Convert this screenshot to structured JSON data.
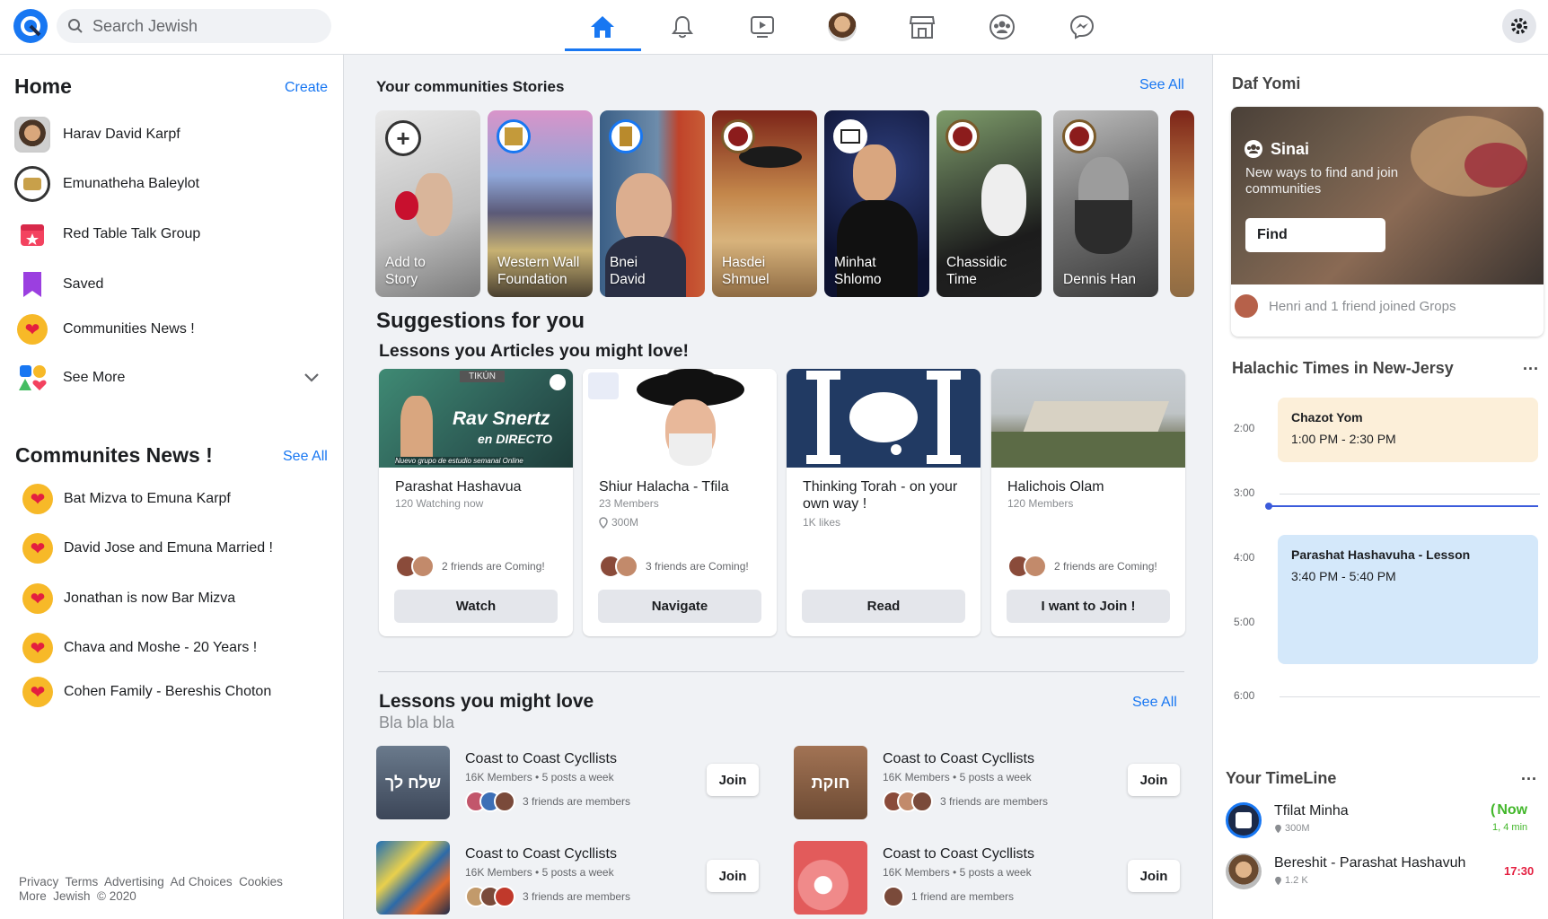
{
  "topbar": {
    "search_placeholder": "Search Jewish",
    "nav_icons": [
      "home-icon",
      "bell-icon",
      "video-icon",
      "profile-avatar",
      "marketplace-icon",
      "groups-icon",
      "messenger-icon"
    ],
    "settings_icon": "gear-icon"
  },
  "left": {
    "title": "Home",
    "create_label": "Create",
    "menu": [
      {
        "label": "Harav David Karpf",
        "icon": "avatar"
      },
      {
        "label": "Emunatheha Baleylot",
        "icon": "community-logo"
      },
      {
        "label": "Red Table Talk Group",
        "icon": "calendar-icon"
      },
      {
        "label": "Saved",
        "icon": "bookmark-icon"
      },
      {
        "label": "Communities News !",
        "icon": "heart-icon"
      },
      {
        "label": "See More",
        "icon": "shapes-icon"
      }
    ],
    "news_title": "Communites News !",
    "news_see_all": "See All",
    "news": [
      "Bat Mizva to Emuna Karpf",
      "David Jose and Emuna Married !",
      "Jonathan is now Bar Mizva",
      "Chava and Moshe - 20 Years !",
      "Cohen Family - Bereshis Choton"
    ],
    "footer_line1": "Privacy  Terms  Advertising  Ad Choices  Cookies",
    "footer_line2": "More  Jewish  © 2020"
  },
  "stories": {
    "title": "Your communities Stories",
    "see_all": "See All",
    "items": [
      {
        "label1": "Add to",
        "label2": "Story"
      },
      {
        "label1": "Western Wall",
        "label2": "Foundation"
      },
      {
        "label1": "Bnei",
        "label2": "David"
      },
      {
        "label1": "Hasdei",
        "label2": "Shmuel"
      },
      {
        "label1": "Minhat",
        "label2": "Shlomo"
      },
      {
        "label1": "Chassidic",
        "label2": "Time"
      },
      {
        "label1": "Dennis Han",
        "label2": ""
      }
    ]
  },
  "suggestions": {
    "title": "Suggestions for you",
    "subtitle": "Lessons you Articles you might love!",
    "cards": [
      {
        "title": "Parashat Hashavua",
        "sub": "120 Watching now",
        "sub2": "",
        "friends": "2 friends are Coming!",
        "button": "Watch",
        "thumb_text1": "Rav Snertz",
        "thumb_text2": "en DIRECTO",
        "thumb_text3": "Nuevo grupo de estudio semanal Online",
        "thumb_tag": "TIKÚN"
      },
      {
        "title": "Shiur Halacha - Tfila",
        "sub": "23  Members",
        "sub2": "300M",
        "friends": "3 friends are Coming!",
        "button": "Navigate"
      },
      {
        "title": "Thinking Torah - on your own way !",
        "sub": "1K likes",
        "sub2": "",
        "friends": "",
        "button": "Read"
      },
      {
        "title": "Halichois Olam",
        "sub": "120 Members",
        "sub2": "",
        "friends": "2 friends are Coming!",
        "button": "I want to Join !"
      }
    ]
  },
  "lessons": {
    "title": "Lessons you might love",
    "subtitle": "Bla bla bla",
    "see_all": "See All",
    "items": [
      {
        "title": "Coast to Coast Cycllists",
        "meta": "16K Members • 5 posts a week",
        "friends": "3 friends are members",
        "join": "Join",
        "thumb_text": "שלח לך"
      },
      {
        "title": "Coast to Coast Cycllists",
        "meta": "16K Members • 5 posts a week",
        "friends": "3 friends are members",
        "join": "Join",
        "thumb_text": "חוקת"
      },
      {
        "title": "Coast to Coast Cycllists",
        "meta": "16K Members • 5 posts a week",
        "friends": "3 friends are members",
        "join": "Join",
        "thumb_text": ""
      },
      {
        "title": "Coast to Coast Cycllists",
        "meta": "16K Members • 5 posts a week",
        "friends": "1 friend are members",
        "join": "Join",
        "thumb_text": ""
      }
    ]
  },
  "right": {
    "daf_title": "Daf Yomi",
    "promo_name": "Sinai",
    "promo_text": "New ways to find and join communities",
    "find_label": "Find",
    "joined_text": "Henri and 1 friend joined Grops",
    "times_title": "Halachic Times in New-Jersy",
    "times_more": "...",
    "hours": [
      "2:00",
      "3:00",
      "4:00",
      "5:00",
      "6:00"
    ],
    "events": [
      {
        "title": "Chazot Yom",
        "time": "1:00 PM - 2:30 PM",
        "color": "#fcefd9"
      },
      {
        "title": "Parashat Hashavuha - Lesson",
        "time": "3:40 PM - 5:40 PM",
        "color": "#d4e8fa"
      }
    ],
    "timeline_title": "Your TimeLine",
    "timeline_more": "...",
    "timeline": [
      {
        "title": "Tfilat Minha",
        "meta": "300M",
        "status": "Now",
        "status2": "1, 4 min",
        "status_color": "#42b72a"
      },
      {
        "title": "Bereshit - Parashat Hashavuh",
        "meta": "1.2 K",
        "status": "17:30",
        "status2": "",
        "status_color": "#e41e3f"
      }
    ]
  },
  "colors": {
    "accent": "#1877f2",
    "now": "#42b72a",
    "time_alert": "#e41e3f"
  }
}
